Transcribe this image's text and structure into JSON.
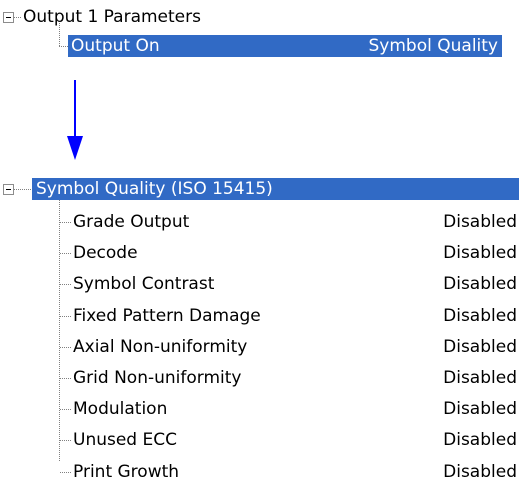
{
  "top_tree": {
    "parent_label": "Output 1 Parameters",
    "child_label": "Output On",
    "child_value": "Symbol Quality"
  },
  "bottom_tree": {
    "parent_label": "Symbol Quality (ISO 15415)",
    "items": [
      {
        "label": "Grade Output",
        "value": "Disabled"
      },
      {
        "label": "Decode",
        "value": "Disabled"
      },
      {
        "label": "Symbol Contrast",
        "value": "Disabled"
      },
      {
        "label": "Fixed Pattern Damage",
        "value": "Disabled"
      },
      {
        "label": "Axial Non-uniformity",
        "value": "Disabled"
      },
      {
        "label": "Grid Non-uniformity",
        "value": "Disabled"
      },
      {
        "label": "Modulation",
        "value": "Disabled"
      },
      {
        "label": "Unused ECC",
        "value": "Disabled"
      },
      {
        "label": "Print Growth",
        "value": "Disabled"
      }
    ]
  },
  "colors": {
    "selection": "#316ac5",
    "arrow": "#0000ff"
  }
}
